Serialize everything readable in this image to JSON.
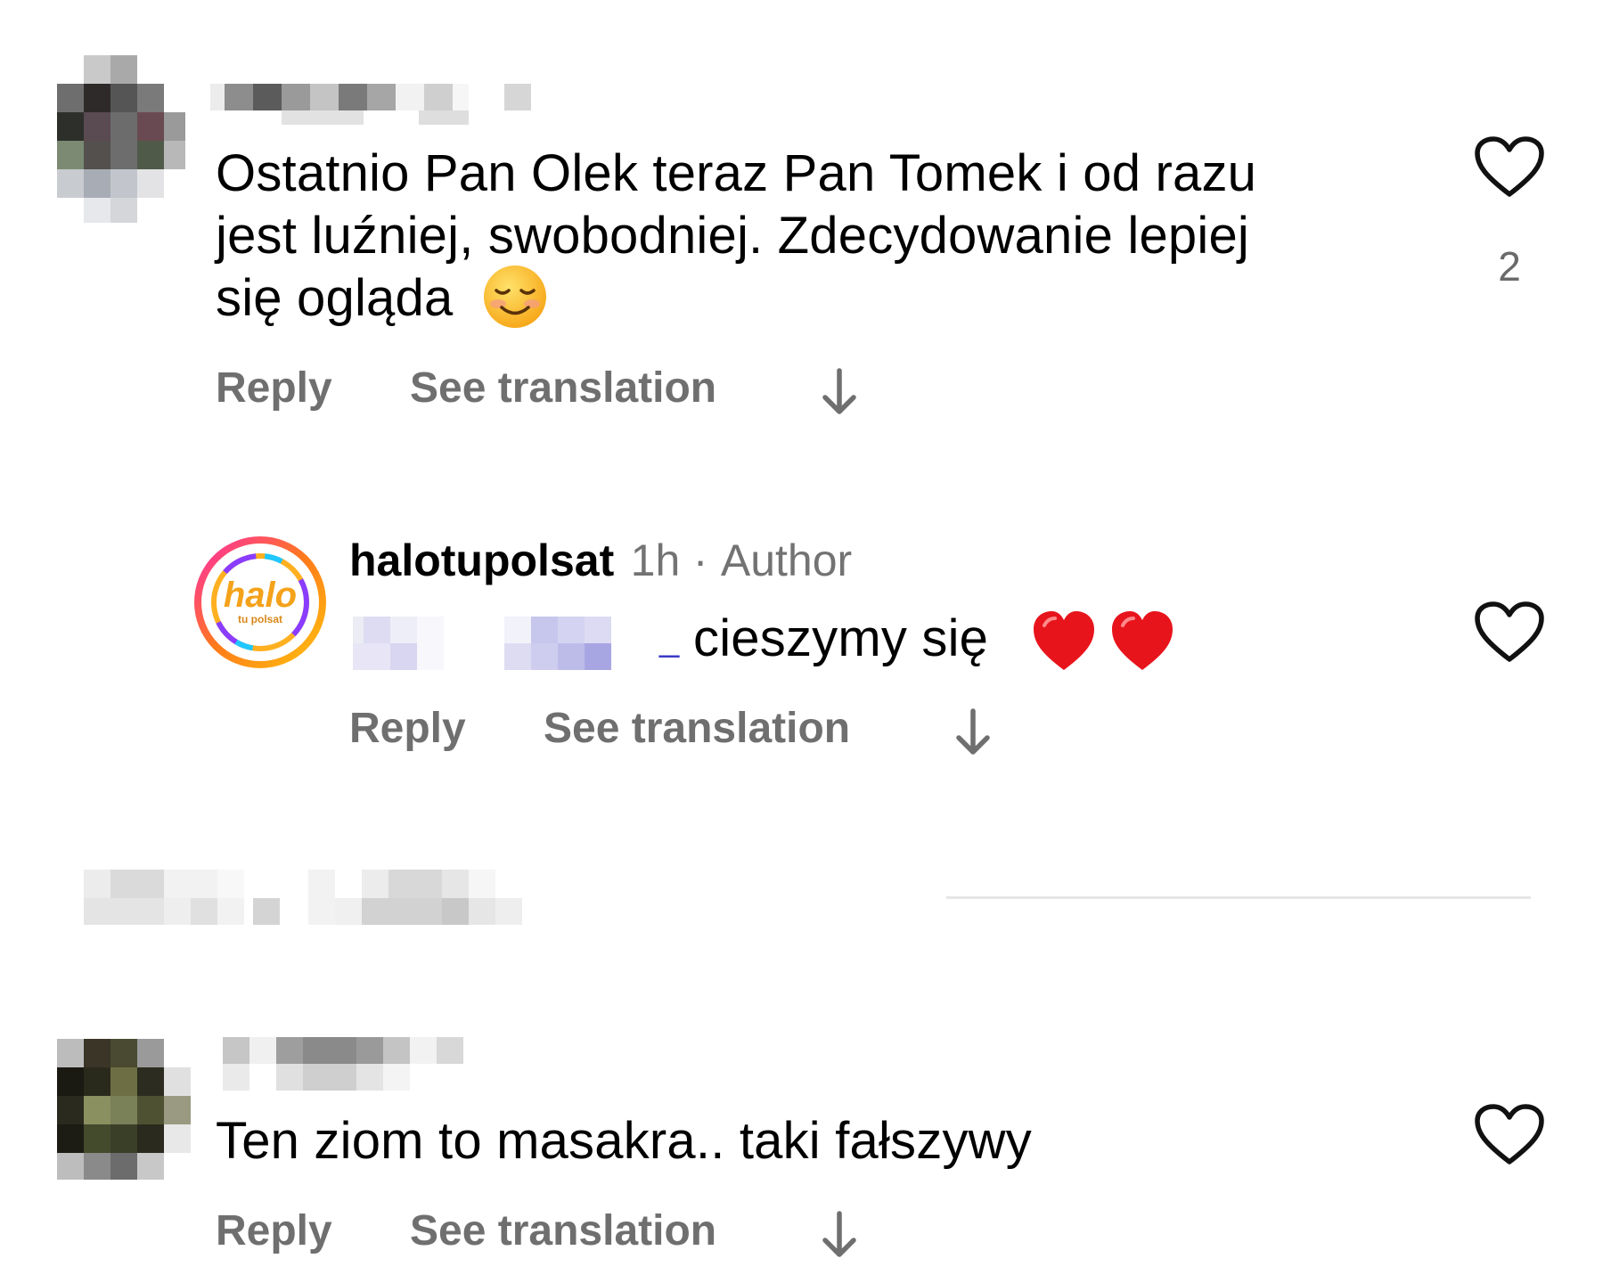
{
  "comments": [
    {
      "text_line1": "Ostatnio Pan Olek teraz Pan Tomek i od razu",
      "text_line2": "jest luźniej, swobodniej. Zdecydowanie lepiej",
      "text_line3": "się ogląda",
      "emoji": "☺",
      "like_count": "2",
      "reply_label": "Reply",
      "translate_label": "See translation"
    },
    {
      "username": "halotupolsat",
      "time": "1h",
      "separator": "·",
      "author_badge": "Author",
      "mention_suffix": "_",
      "text": "cieszymy się",
      "hearts": "❤ ❤",
      "reply_label": "Reply",
      "translate_label": "See translation",
      "avatar_logo": "halo",
      "avatar_sub": "tu polsat"
    },
    {
      "text": "Ten ziom to masakra.. taki fałszywy",
      "reply_label": "Reply",
      "translate_label": "See translation"
    }
  ],
  "colors": {
    "action_gray": "#6f6f6f",
    "heart_red": "#e8141c",
    "divider": "#e6e6e6"
  },
  "icons": [
    "heart-outline-icon",
    "arrow-down-icon",
    "avatar"
  ]
}
